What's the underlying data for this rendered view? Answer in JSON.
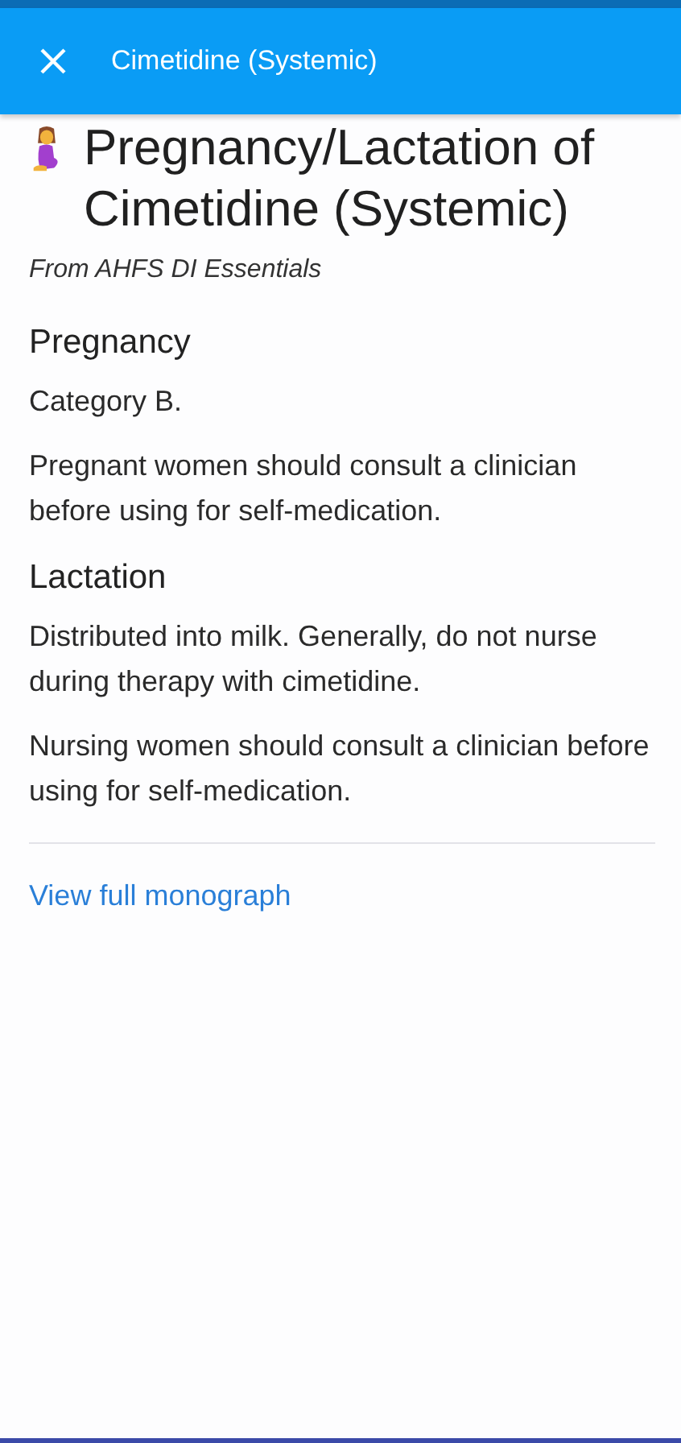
{
  "app_bar": {
    "title": "Cimetidine (Systemic)"
  },
  "heading": "Pregnancy/Lactation of Cimetidine (Systemic)",
  "source": "From AHFS DI Essentials",
  "sections": [
    {
      "title": "Pregnancy",
      "paragraphs": [
        "Category B.",
        "Pregnant women should consult a clinician before using for self-medication."
      ]
    },
    {
      "title": "Lactation",
      "paragraphs": [
        "Distributed into milk. Generally, do not nurse during therapy with cimetidine.",
        "Nursing women should consult a clinician before using for self-medication."
      ]
    }
  ],
  "link": "View full monograph"
}
